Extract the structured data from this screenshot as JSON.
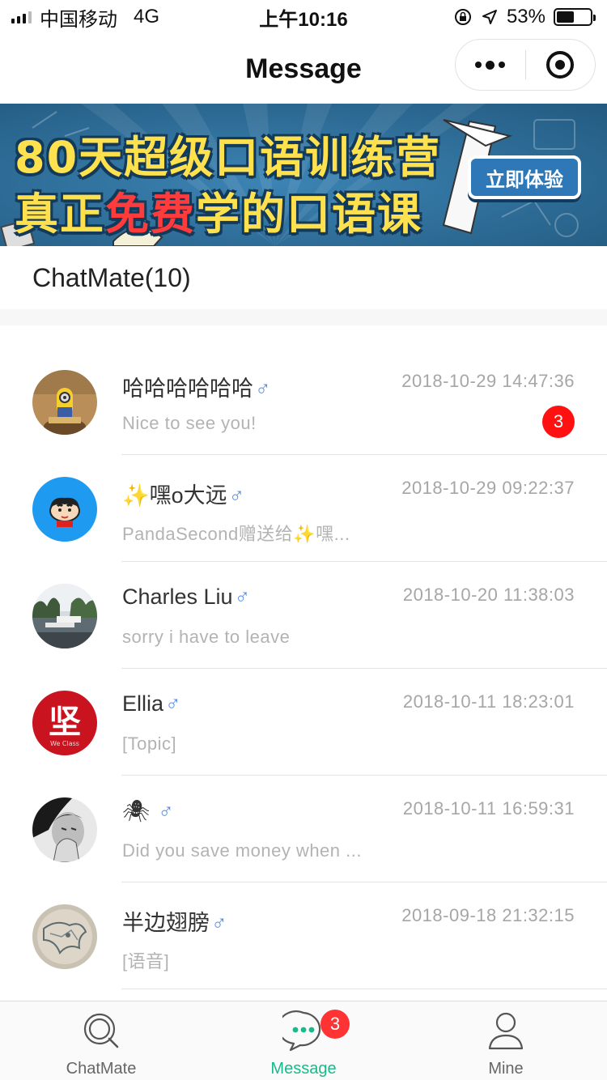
{
  "status_bar": {
    "carrier": "中国移动",
    "network": "4G",
    "time": "上午10:16",
    "battery": "53%",
    "battery_level": 0.53
  },
  "nav": {
    "title": "Message",
    "more_icon": "more-dots-icon",
    "close_icon": "target-circle-icon"
  },
  "banner": {
    "line1": "80天超级口语训练营",
    "line2_prefix": "真正",
    "line2_highlight": "免费",
    "line2_suffix": "学的口语课",
    "cta": "立即体验",
    "colors": {
      "background": "#2d6f9b",
      "headline": "#ffe04d",
      "highlight": "#ff3b3b"
    }
  },
  "section": {
    "title": "ChatMate(10)"
  },
  "conversations": [
    {
      "name": "哈哈哈哈哈哈",
      "gender_symbol": "♂",
      "time": "2018-10-29 14:47:36",
      "preview": "Nice to see you!",
      "unread": "3",
      "avatar": "minion-figure-avatar"
    },
    {
      "name": "✨嘿o大远",
      "gender_symbol": "♂",
      "time": "2018-10-29 09:22:37",
      "preview": "PandaSecond赠送给✨嘿...",
      "unread": "",
      "avatar": "cartoon-boy-avatar"
    },
    {
      "name": "Charles Liu",
      "gender_symbol": "♂",
      "time": "2018-10-20 11:38:03",
      "preview": "sorry i have to leave",
      "unread": "",
      "avatar": "harbor-photo-avatar"
    },
    {
      "name": "Ellia",
      "gender_symbol": "♂",
      "time": "2018-10-11 18:23:01",
      "preview": "[Topic]",
      "unread": "",
      "avatar": "red-logo-avatar"
    },
    {
      "name": "🕷",
      "gender_symbol": "♂",
      "time": "2018-10-11 16:59:31",
      "preview": "Did you save money when ...",
      "unread": "",
      "avatar": "bw-portrait-avatar"
    },
    {
      "name": "半边翅膀",
      "gender_symbol": "♂",
      "time": "2018-09-18 21:32:15",
      "preview": "[语音]",
      "unread": "",
      "avatar": "sketch-avatar"
    }
  ],
  "tab_bar": {
    "tabs": [
      {
        "label": "ChatMate",
        "icon": "search-bubble-icon",
        "active": false
      },
      {
        "label": "Message",
        "icon": "chat-bubble-icon",
        "active": true,
        "badge": "3"
      },
      {
        "label": "Mine",
        "icon": "person-icon",
        "active": false
      }
    ],
    "active_color": "#1ab98a"
  },
  "avatar_texts": {
    "ellia_logo": "坚",
    "ellia_sub": "We Class"
  }
}
